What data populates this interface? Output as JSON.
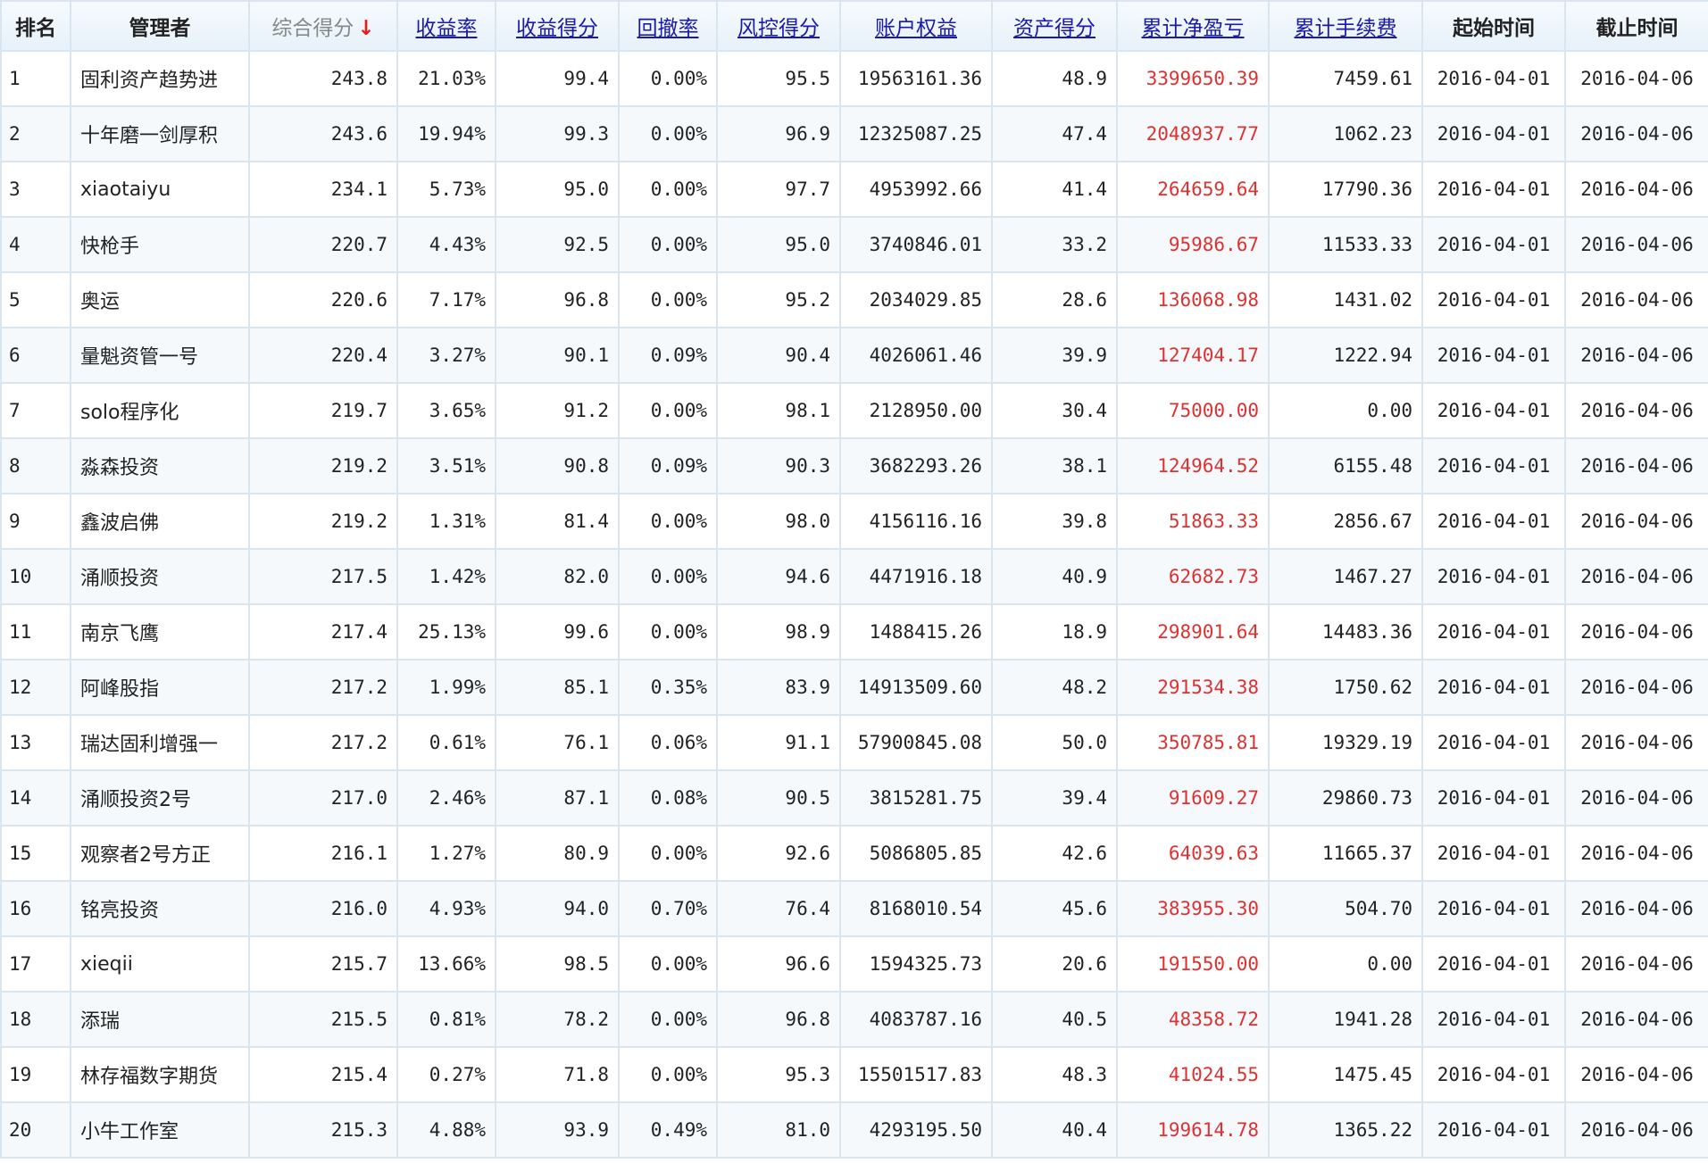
{
  "table": {
    "headers": [
      {
        "key": "rank",
        "label": "排名",
        "style": "plain"
      },
      {
        "key": "manager",
        "label": "管理者",
        "style": "plain"
      },
      {
        "key": "total_score",
        "label": "综合得分",
        "style": "sorted",
        "sort_indicator": "↓"
      },
      {
        "key": "return_rate",
        "label": "收益率",
        "style": "link"
      },
      {
        "key": "return_score",
        "label": "收益得分",
        "style": "link"
      },
      {
        "key": "drawdown",
        "label": "回撤率",
        "style": "link"
      },
      {
        "key": "risk_score",
        "label": "风控得分",
        "style": "link"
      },
      {
        "key": "equity",
        "label": "账户权益",
        "style": "link"
      },
      {
        "key": "asset_score",
        "label": "资产得分",
        "style": "link"
      },
      {
        "key": "cum_pnl",
        "label": "累计净盈亏",
        "style": "link"
      },
      {
        "key": "cum_fee",
        "label": "累计手续费",
        "style": "link"
      },
      {
        "key": "start",
        "label": "起始时间",
        "style": "plain"
      },
      {
        "key": "end",
        "label": "截止时间",
        "style": "plain"
      }
    ],
    "colors": {
      "pnl": "#e03030",
      "link": "#1a1aaa",
      "sort_arrow": "#e02020",
      "border": "#d9e6f0"
    },
    "rows": [
      {
        "rank": "1",
        "manager": "固利资产趋势进",
        "total_score": "243.8",
        "return_rate": "21.03%",
        "return_score": "99.4",
        "drawdown": "0.00%",
        "risk_score": "95.5",
        "equity": "19563161.36",
        "asset_score": "48.9",
        "cum_pnl": "3399650.39",
        "cum_fee": "7459.61",
        "start": "2016-04-01",
        "end": "2016-04-06"
      },
      {
        "rank": "2",
        "manager": "十年磨一剑厚积",
        "total_score": "243.6",
        "return_rate": "19.94%",
        "return_score": "99.3",
        "drawdown": "0.00%",
        "risk_score": "96.9",
        "equity": "12325087.25",
        "asset_score": "47.4",
        "cum_pnl": "2048937.77",
        "cum_fee": "1062.23",
        "start": "2016-04-01",
        "end": "2016-04-06"
      },
      {
        "rank": "3",
        "manager": "xiaotaiyu",
        "total_score": "234.1",
        "return_rate": "5.73%",
        "return_score": "95.0",
        "drawdown": "0.00%",
        "risk_score": "97.7",
        "equity": "4953992.66",
        "asset_score": "41.4",
        "cum_pnl": "264659.64",
        "cum_fee": "17790.36",
        "start": "2016-04-01",
        "end": "2016-04-06"
      },
      {
        "rank": "4",
        "manager": "快枪手",
        "total_score": "220.7",
        "return_rate": "4.43%",
        "return_score": "92.5",
        "drawdown": "0.00%",
        "risk_score": "95.0",
        "equity": "3740846.01",
        "asset_score": "33.2",
        "cum_pnl": "95986.67",
        "cum_fee": "11533.33",
        "start": "2016-04-01",
        "end": "2016-04-06"
      },
      {
        "rank": "5",
        "manager": "奥运",
        "total_score": "220.6",
        "return_rate": "7.17%",
        "return_score": "96.8",
        "drawdown": "0.00%",
        "risk_score": "95.2",
        "equity": "2034029.85",
        "asset_score": "28.6",
        "cum_pnl": "136068.98",
        "cum_fee": "1431.02",
        "start": "2016-04-01",
        "end": "2016-04-06"
      },
      {
        "rank": "6",
        "manager": "量魁资管一号",
        "total_score": "220.4",
        "return_rate": "3.27%",
        "return_score": "90.1",
        "drawdown": "0.09%",
        "risk_score": "90.4",
        "equity": "4026061.46",
        "asset_score": "39.9",
        "cum_pnl": "127404.17",
        "cum_fee": "1222.94",
        "start": "2016-04-01",
        "end": "2016-04-06"
      },
      {
        "rank": "7",
        "manager": "solo程序化",
        "total_score": "219.7",
        "return_rate": "3.65%",
        "return_score": "91.2",
        "drawdown": "0.00%",
        "risk_score": "98.1",
        "equity": "2128950.00",
        "asset_score": "30.4",
        "cum_pnl": "75000.00",
        "cum_fee": "0.00",
        "start": "2016-04-01",
        "end": "2016-04-06"
      },
      {
        "rank": "8",
        "manager": "淼森投资",
        "total_score": "219.2",
        "return_rate": "3.51%",
        "return_score": "90.8",
        "drawdown": "0.09%",
        "risk_score": "90.3",
        "equity": "3682293.26",
        "asset_score": "38.1",
        "cum_pnl": "124964.52",
        "cum_fee": "6155.48",
        "start": "2016-04-01",
        "end": "2016-04-06"
      },
      {
        "rank": "9",
        "manager": "鑫波启佛",
        "total_score": "219.2",
        "return_rate": "1.31%",
        "return_score": "81.4",
        "drawdown": "0.00%",
        "risk_score": "98.0",
        "equity": "4156116.16",
        "asset_score": "39.8",
        "cum_pnl": "51863.33",
        "cum_fee": "2856.67",
        "start": "2016-04-01",
        "end": "2016-04-06"
      },
      {
        "rank": "10",
        "manager": "涌顺投资",
        "total_score": "217.5",
        "return_rate": "1.42%",
        "return_score": "82.0",
        "drawdown": "0.00%",
        "risk_score": "94.6",
        "equity": "4471916.18",
        "asset_score": "40.9",
        "cum_pnl": "62682.73",
        "cum_fee": "1467.27",
        "start": "2016-04-01",
        "end": "2016-04-06"
      },
      {
        "rank": "11",
        "manager": "南京飞鹰",
        "total_score": "217.4",
        "return_rate": "25.13%",
        "return_score": "99.6",
        "drawdown": "0.00%",
        "risk_score": "98.9",
        "equity": "1488415.26",
        "asset_score": "18.9",
        "cum_pnl": "298901.64",
        "cum_fee": "14483.36",
        "start": "2016-04-01",
        "end": "2016-04-06"
      },
      {
        "rank": "12",
        "manager": "阿峰股指",
        "total_score": "217.2",
        "return_rate": "1.99%",
        "return_score": "85.1",
        "drawdown": "0.35%",
        "risk_score": "83.9",
        "equity": "14913509.60",
        "asset_score": "48.2",
        "cum_pnl": "291534.38",
        "cum_fee": "1750.62",
        "start": "2016-04-01",
        "end": "2016-04-06"
      },
      {
        "rank": "13",
        "manager": "瑞达固利增强一",
        "total_score": "217.2",
        "return_rate": "0.61%",
        "return_score": "76.1",
        "drawdown": "0.06%",
        "risk_score": "91.1",
        "equity": "57900845.08",
        "asset_score": "50.0",
        "cum_pnl": "350785.81",
        "cum_fee": "19329.19",
        "start": "2016-04-01",
        "end": "2016-04-06"
      },
      {
        "rank": "14",
        "manager": "涌顺投资2号",
        "total_score": "217.0",
        "return_rate": "2.46%",
        "return_score": "87.1",
        "drawdown": "0.08%",
        "risk_score": "90.5",
        "equity": "3815281.75",
        "asset_score": "39.4",
        "cum_pnl": "91609.27",
        "cum_fee": "29860.73",
        "start": "2016-04-01",
        "end": "2016-04-06"
      },
      {
        "rank": "15",
        "manager": "观察者2号方正",
        "total_score": "216.1",
        "return_rate": "1.27%",
        "return_score": "80.9",
        "drawdown": "0.00%",
        "risk_score": "92.6",
        "equity": "5086805.85",
        "asset_score": "42.6",
        "cum_pnl": "64039.63",
        "cum_fee": "11665.37",
        "start": "2016-04-01",
        "end": "2016-04-06"
      },
      {
        "rank": "16",
        "manager": "铭亮投资",
        "total_score": "216.0",
        "return_rate": "4.93%",
        "return_score": "94.0",
        "drawdown": "0.70%",
        "risk_score": "76.4",
        "equity": "8168010.54",
        "asset_score": "45.6",
        "cum_pnl": "383955.30",
        "cum_fee": "504.70",
        "start": "2016-04-01",
        "end": "2016-04-06"
      },
      {
        "rank": "17",
        "manager": "xieqii",
        "total_score": "215.7",
        "return_rate": "13.66%",
        "return_score": "98.5",
        "drawdown": "0.00%",
        "risk_score": "96.6",
        "equity": "1594325.73",
        "asset_score": "20.6",
        "cum_pnl": "191550.00",
        "cum_fee": "0.00",
        "start": "2016-04-01",
        "end": "2016-04-06"
      },
      {
        "rank": "18",
        "manager": "添瑞",
        "total_score": "215.5",
        "return_rate": "0.81%",
        "return_score": "78.2",
        "drawdown": "0.00%",
        "risk_score": "96.8",
        "equity": "4083787.16",
        "asset_score": "40.5",
        "cum_pnl": "48358.72",
        "cum_fee": "1941.28",
        "start": "2016-04-01",
        "end": "2016-04-06"
      },
      {
        "rank": "19",
        "manager": "林存福数字期货",
        "total_score": "215.4",
        "return_rate": "0.27%",
        "return_score": "71.8",
        "drawdown": "0.00%",
        "risk_score": "95.3",
        "equity": "15501517.83",
        "asset_score": "48.3",
        "cum_pnl": "41024.55",
        "cum_fee": "1475.45",
        "start": "2016-04-01",
        "end": "2016-04-06"
      },
      {
        "rank": "20",
        "manager": "小牛工作室",
        "total_score": "215.3",
        "return_rate": "4.88%",
        "return_score": "93.9",
        "drawdown": "0.49%",
        "risk_score": "81.0",
        "equity": "4293195.50",
        "asset_score": "40.4",
        "cum_pnl": "199614.78",
        "cum_fee": "1365.22",
        "start": "2016-04-01",
        "end": "2016-04-06"
      }
    ]
  }
}
